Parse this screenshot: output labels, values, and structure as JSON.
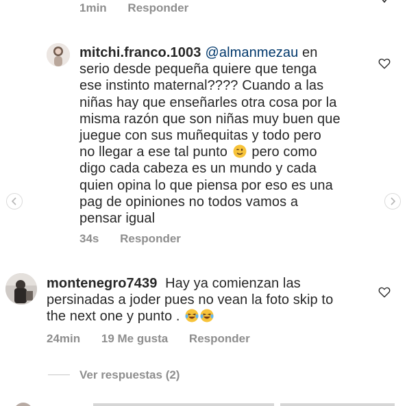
{
  "top_comment": {
    "time": "1min",
    "reply_label": "Responder"
  },
  "comment1": {
    "username": "mitchi.franco.1003",
    "mention": "@almanmezau",
    "lines": [
      "en",
      "serio desde pequeña quiere que tenga",
      "ese instinto maternal???? Cuando a las",
      "niñas hay que enseñarles otra cosa por la",
      "misma razón que son niñas muy buen que",
      "juegue con sus muñequitas y todo pero",
      "no llegar a ese tal punto",
      "pero como",
      "digo cada cabeza es un mundo y cada",
      "quien opina lo que piensa por eso es una",
      "pag de opiniones no todos vamos a",
      "pensar igual"
    ],
    "time": "34s",
    "reply_label": "Responder",
    "emoji": "winking-face"
  },
  "comment2": {
    "username": "montenegro7439",
    "lines": [
      "Hay ya comienzan las",
      "persinadas a joder pues no vean  la foto skip to",
      "the next one y punto ."
    ],
    "time": "24min",
    "likes": "19 Me gusta",
    "reply_label": "Responder",
    "emoji": "laughing-tears-face"
  },
  "view_replies": "Ver respuestas (2)",
  "colors": {
    "text": "#262626",
    "meta": "#8e8e8e",
    "mention": "#00376b",
    "border": "#dbdbdb"
  }
}
